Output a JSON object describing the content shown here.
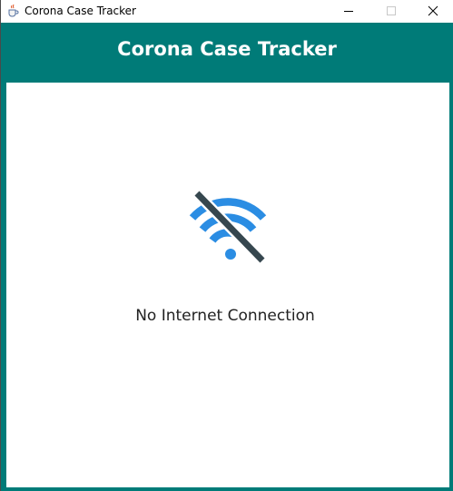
{
  "window": {
    "title": "Corona Case Tracker",
    "app_icon": "java-coffee-cup-icon",
    "controls": [
      "minimize-icon",
      "maximize-icon",
      "close-icon"
    ]
  },
  "header": {
    "title": "Corona Case Tracker",
    "background_color": "#007b78",
    "text_color": "#ffffff"
  },
  "main": {
    "status_icon": "no-wifi-icon",
    "status_message": "No Internet Connection",
    "icon_color": "#2b8de3",
    "slash_color": "#36474f"
  }
}
